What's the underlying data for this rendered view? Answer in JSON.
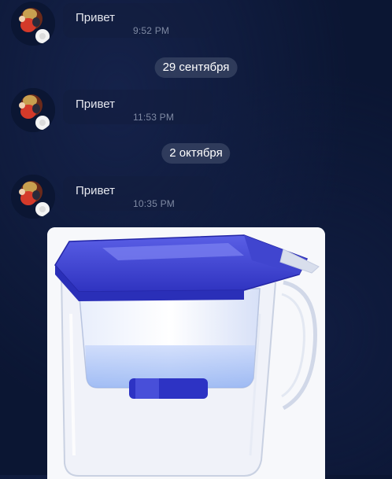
{
  "messages": [
    {
      "text": "Привет",
      "time": "9:52 PM"
    },
    {
      "text": "Привет",
      "time": "11:53 PM"
    },
    {
      "text": "Привет",
      "time": "10:35 PM"
    }
  ],
  "date_separators": [
    {
      "label": "29 сентября"
    },
    {
      "label": "2 октября"
    }
  ],
  "icons": {
    "avatar": "avatar-icon",
    "photo": "water-filter-pitcher-photo"
  },
  "colors": {
    "background": "#0b1633",
    "message_text": "#e6e8ef",
    "time_text": "#7f8aa3",
    "date_pill": "#3a4664",
    "pitcher_blue": "#3b3fd4"
  }
}
